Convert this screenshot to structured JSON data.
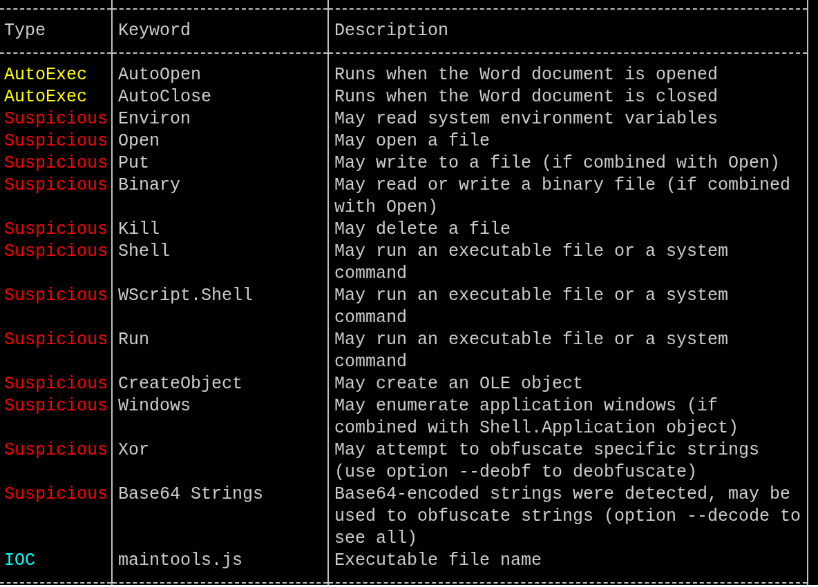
{
  "table": {
    "columns": [
      "Type",
      "Keyword",
      "Description"
    ],
    "rows": [
      {
        "type": "AutoExec",
        "color": "#ffff00",
        "keyword": "AutoOpen",
        "description": [
          "Runs when the Word document is opened"
        ]
      },
      {
        "type": "AutoExec",
        "color": "#ffff00",
        "keyword": "AutoClose",
        "description": [
          "Runs when the Word document is closed"
        ]
      },
      {
        "type": "Suspicious",
        "color": "#ff0000",
        "keyword": "Environ",
        "description": [
          "May read system environment variables"
        ]
      },
      {
        "type": "Suspicious",
        "color": "#ff0000",
        "keyword": "Open",
        "description": [
          "May open a file"
        ]
      },
      {
        "type": "Suspicious",
        "color": "#ff0000",
        "keyword": "Put",
        "description": [
          "May write to a file (if combined with Open)"
        ]
      },
      {
        "type": "Suspicious",
        "color": "#ff0000",
        "keyword": "Binary",
        "description": [
          "May read or write a binary file (if combined",
          "with Open)"
        ]
      },
      {
        "type": "Suspicious",
        "color": "#ff0000",
        "keyword": "Kill",
        "description": [
          "May delete a file"
        ]
      },
      {
        "type": "Suspicious",
        "color": "#ff0000",
        "keyword": "Shell",
        "description": [
          "May run an executable file or a system",
          "command"
        ]
      },
      {
        "type": "Suspicious",
        "color": "#ff0000",
        "keyword": "WScript.Shell",
        "description": [
          "May run an executable file or a system",
          "command"
        ]
      },
      {
        "type": "Suspicious",
        "color": "#ff0000",
        "keyword": "Run",
        "description": [
          "May run an executable file or a system",
          "command"
        ]
      },
      {
        "type": "Suspicious",
        "color": "#ff0000",
        "keyword": "CreateObject",
        "description": [
          "May create an OLE object"
        ]
      },
      {
        "type": "Suspicious",
        "color": "#ff0000",
        "keyword": "Windows",
        "description": [
          "May enumerate application windows (if",
          "combined with Shell.Application object)"
        ]
      },
      {
        "type": "Suspicious",
        "color": "#ff0000",
        "keyword": "Xor",
        "description": [
          "May attempt to obfuscate specific strings",
          "(use option --deobf to deobfuscate)"
        ]
      },
      {
        "type": "Suspicious",
        "color": "#ff0000",
        "keyword": "Base64 Strings",
        "description": [
          "Base64-encoded strings were detected, may be",
          "used to obfuscate strings (option --decode to",
          "see all)"
        ]
      },
      {
        "type": "IOC",
        "color": "#00ffff",
        "keyword": "maintools.js",
        "description": [
          "Executable file name"
        ]
      }
    ]
  }
}
